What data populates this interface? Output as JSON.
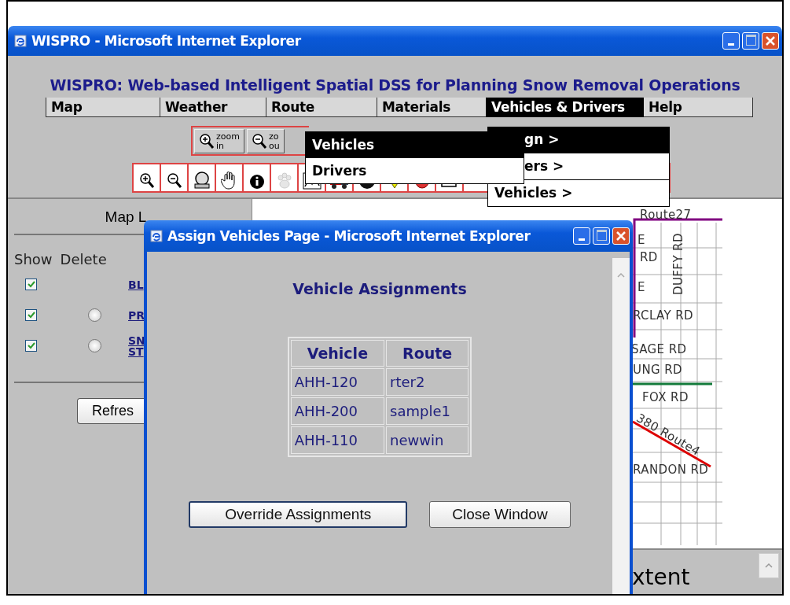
{
  "window": {
    "title": "WISPRO - Microsoft Internet Explorer"
  },
  "page_heading": "WISPRO: Web-based Intelligent Spatial DSS for Planning Snow Removal Operations",
  "menu_bar": [
    {
      "label": "Map",
      "selected": false
    },
    {
      "label": "Weather",
      "selected": false
    },
    {
      "label": "Route",
      "selected": false
    },
    {
      "label": "Materials",
      "selected": false
    },
    {
      "label": "Vehicles & Drivers",
      "selected": true
    },
    {
      "label": "Help",
      "selected": false
    }
  ],
  "zoom_buttons": [
    {
      "kind": "in",
      "top": "zoom",
      "bottom": "in"
    },
    {
      "kind": "out",
      "top": "zo",
      "bottom": "ou"
    }
  ],
  "menu_dropdown": [
    {
      "label": "gn >",
      "selected": true
    },
    {
      "label": "ers >",
      "selected": false
    },
    {
      "label": "Vehicles >",
      "selected": false
    }
  ],
  "submenu": [
    {
      "label": "Vehicles",
      "selected": true
    },
    {
      "label": "Drivers",
      "selected": false
    }
  ],
  "layers_panel": {
    "title": "Map L",
    "columns": [
      "Show",
      "Delete"
    ],
    "layers": [
      {
        "shown": true,
        "delete_option": false,
        "name_lines": [
          "BL"
        ]
      },
      {
        "shown": true,
        "delete_option": true,
        "name_lines": [
          "PR"
        ]
      },
      {
        "shown": true,
        "delete_option": true,
        "name_lines": [
          "SN",
          "ST"
        ]
      }
    ],
    "refresh_button": "Refres"
  },
  "map": {
    "labels": [
      {
        "kind": "route",
        "text": "Route27"
      },
      {
        "kind": "road",
        "text": "E"
      },
      {
        "kind": "road",
        "text": "RD"
      },
      {
        "kind": "vertical",
        "text": "DUFFY RD"
      },
      {
        "kind": "road",
        "text": "E"
      },
      {
        "kind": "road",
        "text": "RCLAY RD"
      },
      {
        "kind": "road",
        "text": "SAGE RD"
      },
      {
        "kind": "road",
        "text": "UNG RD"
      },
      {
        "kind": "road",
        "text": "FOX RD"
      },
      {
        "kind": "slanted",
        "text": "380 Route4"
      },
      {
        "kind": "road",
        "text": "RANDON RD"
      }
    ],
    "bottom_panel_text": "xtent"
  },
  "popup": {
    "title": "Assign Vehicles Page - Microsoft Internet Explorer",
    "heading": "Vehicle Assignments",
    "table": {
      "columns": [
        "Vehicle",
        "Route"
      ],
      "rows": [
        [
          "AHH-120",
          "rter2"
        ],
        [
          "AHH-200",
          "sample1"
        ],
        [
          "AHH-110",
          "newwin"
        ]
      ]
    },
    "buttons": [
      {
        "label": "Override Assignments",
        "focused": true
      },
      {
        "label": "Close Window",
        "focused": false
      }
    ]
  }
}
